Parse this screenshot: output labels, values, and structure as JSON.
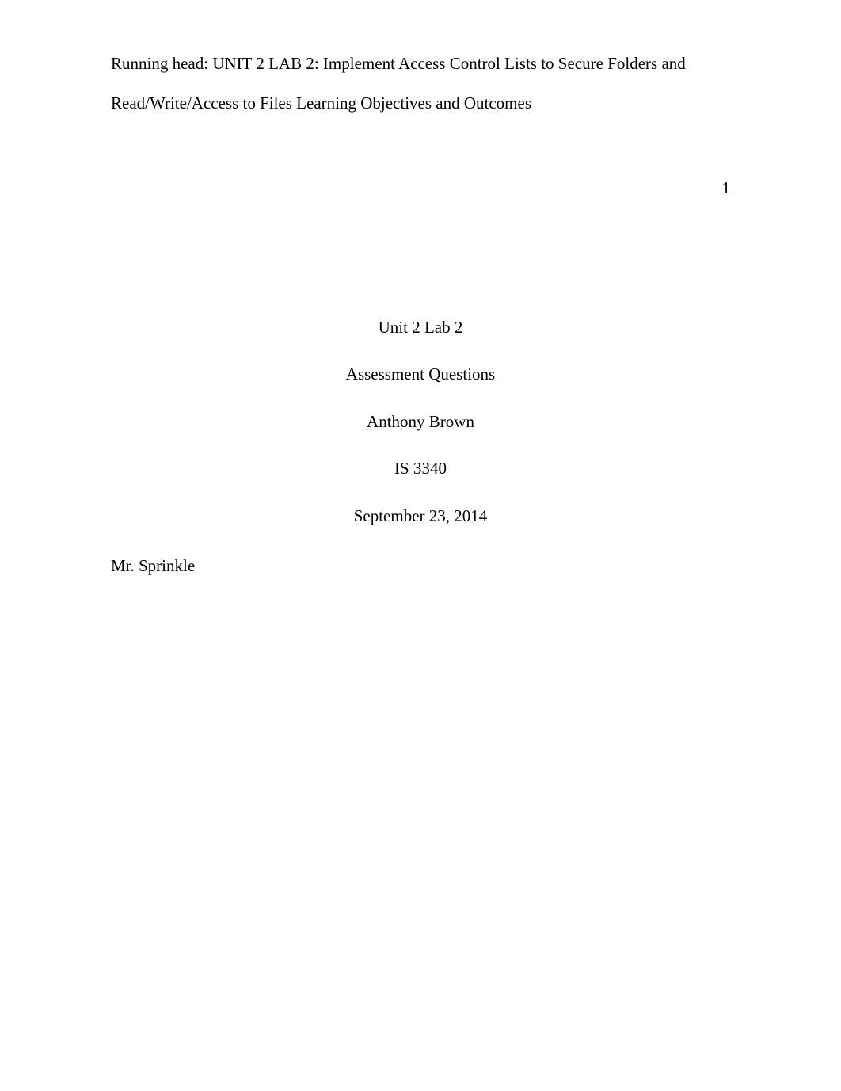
{
  "header": {
    "running_head_line1": "Running head: UNIT 2 LAB 2: Implement Access Control Lists to Secure Folders and",
    "running_head_line2": "Read/Write/Access to Files Learning Objectives and Outcomes",
    "page_number": "1"
  },
  "title_block": {
    "line1": "Unit 2 Lab 2",
    "line2": "Assessment Questions",
    "author": "Anthony Brown",
    "course": "IS 3340",
    "date": "September 23, 2014"
  },
  "instructor": {
    "name": "Mr. Sprinkle"
  }
}
